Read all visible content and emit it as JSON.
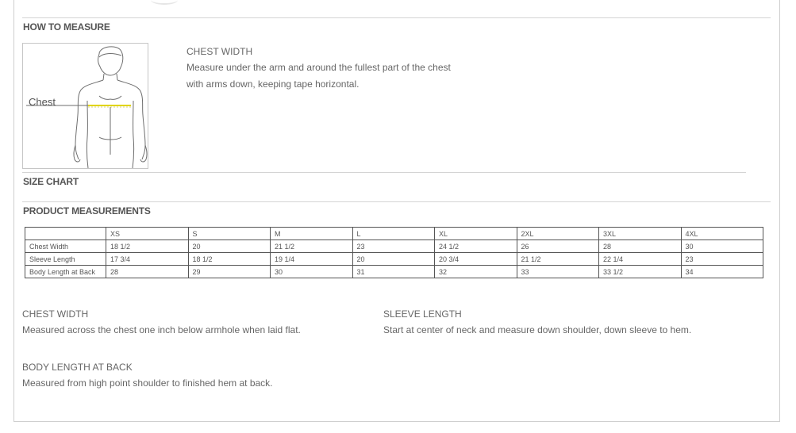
{
  "how_to_measure": {
    "title": "HOW TO MEASURE",
    "figure_label": "Chest",
    "chest": {
      "title": "CHEST WIDTH",
      "line1": "Measure under the arm and around the fullest part of the chest",
      "line2": "with arms down, keeping tape horizontal."
    }
  },
  "size_chart": {
    "title": "SIZE CHART"
  },
  "product_measurements": {
    "title": "PRODUCT MEASUREMENTS",
    "columns": [
      "",
      "XS",
      "S",
      "M",
      "L",
      "XL",
      "2XL",
      "3XL",
      "4XL"
    ],
    "rows": [
      [
        "Chest Width",
        "18 1/2",
        "20",
        "21 1/2",
        "23",
        "24 1/2",
        "26",
        "28",
        "30"
      ],
      [
        "Sleeve Length",
        "17 3/4",
        "18 1/2",
        "19 1/4",
        "20",
        "20 3/4",
        "21 1/2",
        "22 1/4",
        "23"
      ],
      [
        "Body Length at Back",
        "28",
        "29",
        "30",
        "31",
        "32",
        "33",
        "33 1/2",
        "34"
      ]
    ]
  },
  "definitions": {
    "chest_width": {
      "title": "CHEST WIDTH",
      "text": "Measured across the chest one inch below armhole when laid flat."
    },
    "sleeve_length": {
      "title": "SLEEVE LENGTH",
      "text": "Start at center of neck and measure down shoulder, down sleeve to hem."
    },
    "body_length": {
      "title": "BODY LENGTH AT BACK",
      "text": "Measured from high point shoulder to finished hem at back."
    }
  },
  "colors": {
    "tape": "#e1d400",
    "border": "#555555",
    "rule": "#d4d4d4"
  },
  "icons": [
    "human-figure-illustration"
  ]
}
